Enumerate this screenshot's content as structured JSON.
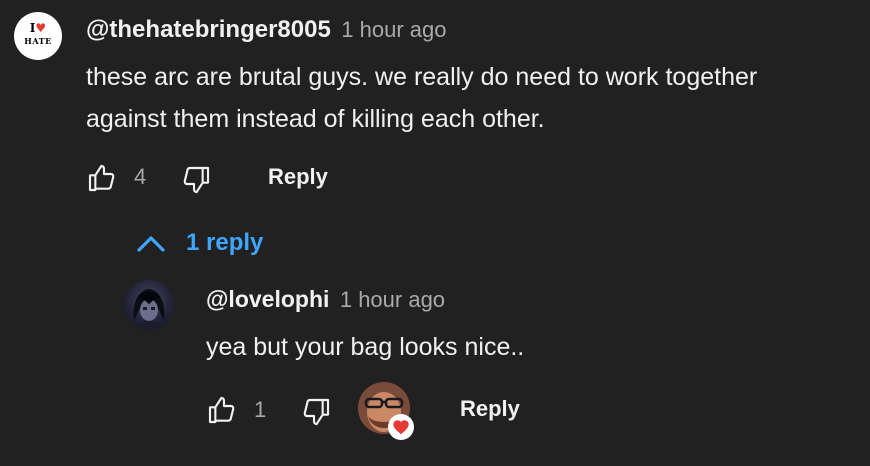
{
  "comment": {
    "avatar_logo_top": "I♥",
    "avatar_logo_bottom": "HATE",
    "handle": "@thehatebringer8005",
    "time": "1 hour ago",
    "text_line1": "these arc are brutal guys. we really do need to work together",
    "text_line2": "against them instead of killing each other.",
    "like_count": "4",
    "reply_label": "Reply",
    "replies_toggle": "1 reply"
  },
  "reply": {
    "handle": "@lovelophi",
    "time": "1 hour ago",
    "text": "yea but your bag looks nice..",
    "like_count": "1",
    "reply_label": "Reply",
    "creator_heart": true
  },
  "colors": {
    "background": "#212121",
    "text_primary": "#f1f1f1",
    "text_secondary": "#aaaaaa",
    "link_blue": "#3ea6ff",
    "heart_red": "#e53935"
  },
  "icons": [
    "thumb-up-icon",
    "thumb-down-icon",
    "chevron-up-icon",
    "heart-icon"
  ]
}
